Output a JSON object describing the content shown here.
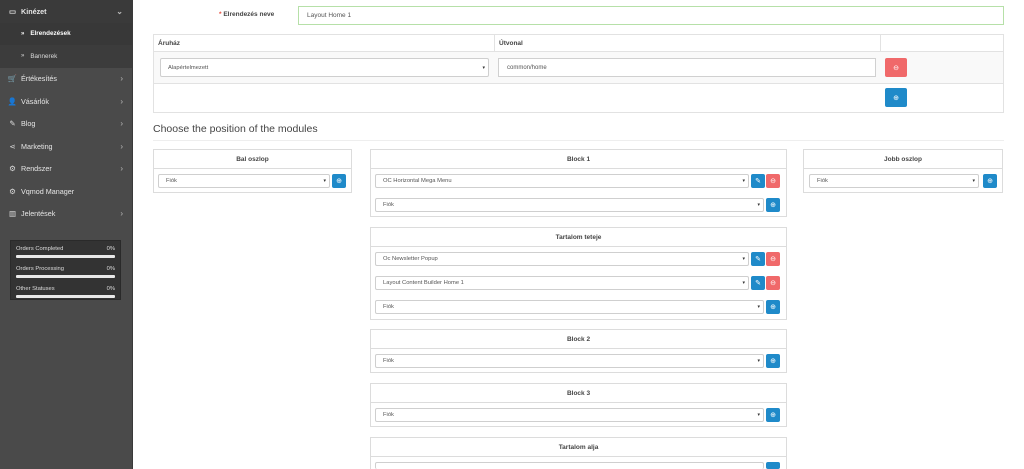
{
  "sidebar": {
    "items": [
      {
        "icon": "monitor-icon",
        "glyph": "▭",
        "label": "Kinézet",
        "chevron": "⌄",
        "active": true
      },
      {
        "icon": "cart-icon",
        "glyph": "🛒",
        "label": "Értékesítés",
        "chevron": "›"
      },
      {
        "icon": "user-icon",
        "glyph": "👤",
        "label": "Vásárlók",
        "chevron": "›"
      },
      {
        "icon": "edit-icon",
        "glyph": "✎",
        "label": "Blog",
        "chevron": "›"
      },
      {
        "icon": "share-icon",
        "glyph": "⋖",
        "label": "Marketing",
        "chevron": "›"
      },
      {
        "icon": "gear-icon",
        "glyph": "⚙",
        "label": "Rendszer",
        "chevron": "›"
      },
      {
        "icon": "gear-icon",
        "glyph": "⚙",
        "label": "Vqmod Manager",
        "chevron": ""
      },
      {
        "icon": "chart-icon",
        "glyph": "▥",
        "label": "Jelentések",
        "chevron": "›"
      }
    ],
    "subitems": [
      {
        "label": "Elrendezések",
        "current": true
      },
      {
        "label": "Bannerek",
        "current": false
      }
    ],
    "stats": [
      {
        "label": "Orders Completed",
        "value": "0%",
        "fraction": 0
      },
      {
        "label": "Orders Processing",
        "value": "0%",
        "fraction": 0
      },
      {
        "label": "Other Statuses",
        "value": "0%",
        "fraction": 0
      }
    ]
  },
  "form": {
    "required_mark": "*",
    "name_label": "Elrendezés neve",
    "name_value": "Layout Home 1"
  },
  "routes": {
    "col_store": "Áruház",
    "col_route": "Útvonal",
    "store_value": "Alapértelmezett",
    "route_value": "common/home"
  },
  "modules": {
    "heading": "Choose the position of the modules",
    "default_option": "Fiók",
    "left": {
      "title": "Bal oszlop"
    },
    "right": {
      "title": "Jobb oszlop"
    },
    "block1": {
      "title": "Block 1",
      "rows": [
        "OC Horizontal Mega Menu"
      ]
    },
    "content_top": {
      "title": "Tartalom teteje",
      "rows": [
        "Oc Newsletter Popup",
        "Layout Content Builder Home 1"
      ]
    },
    "block2": {
      "title": "Block 2"
    },
    "block3": {
      "title": "Block 3"
    },
    "content_bottom": {
      "title": "Tartalom alja"
    }
  },
  "icons": {
    "caret": "▾",
    "pencil": "✎",
    "remove": "⊖",
    "add": "⊕"
  },
  "colors": {
    "sidebar_bg": "#4a4a4a",
    "primary": "#1f8ac9",
    "danger": "#f0696a",
    "focus_border": "#b6e0a8"
  }
}
